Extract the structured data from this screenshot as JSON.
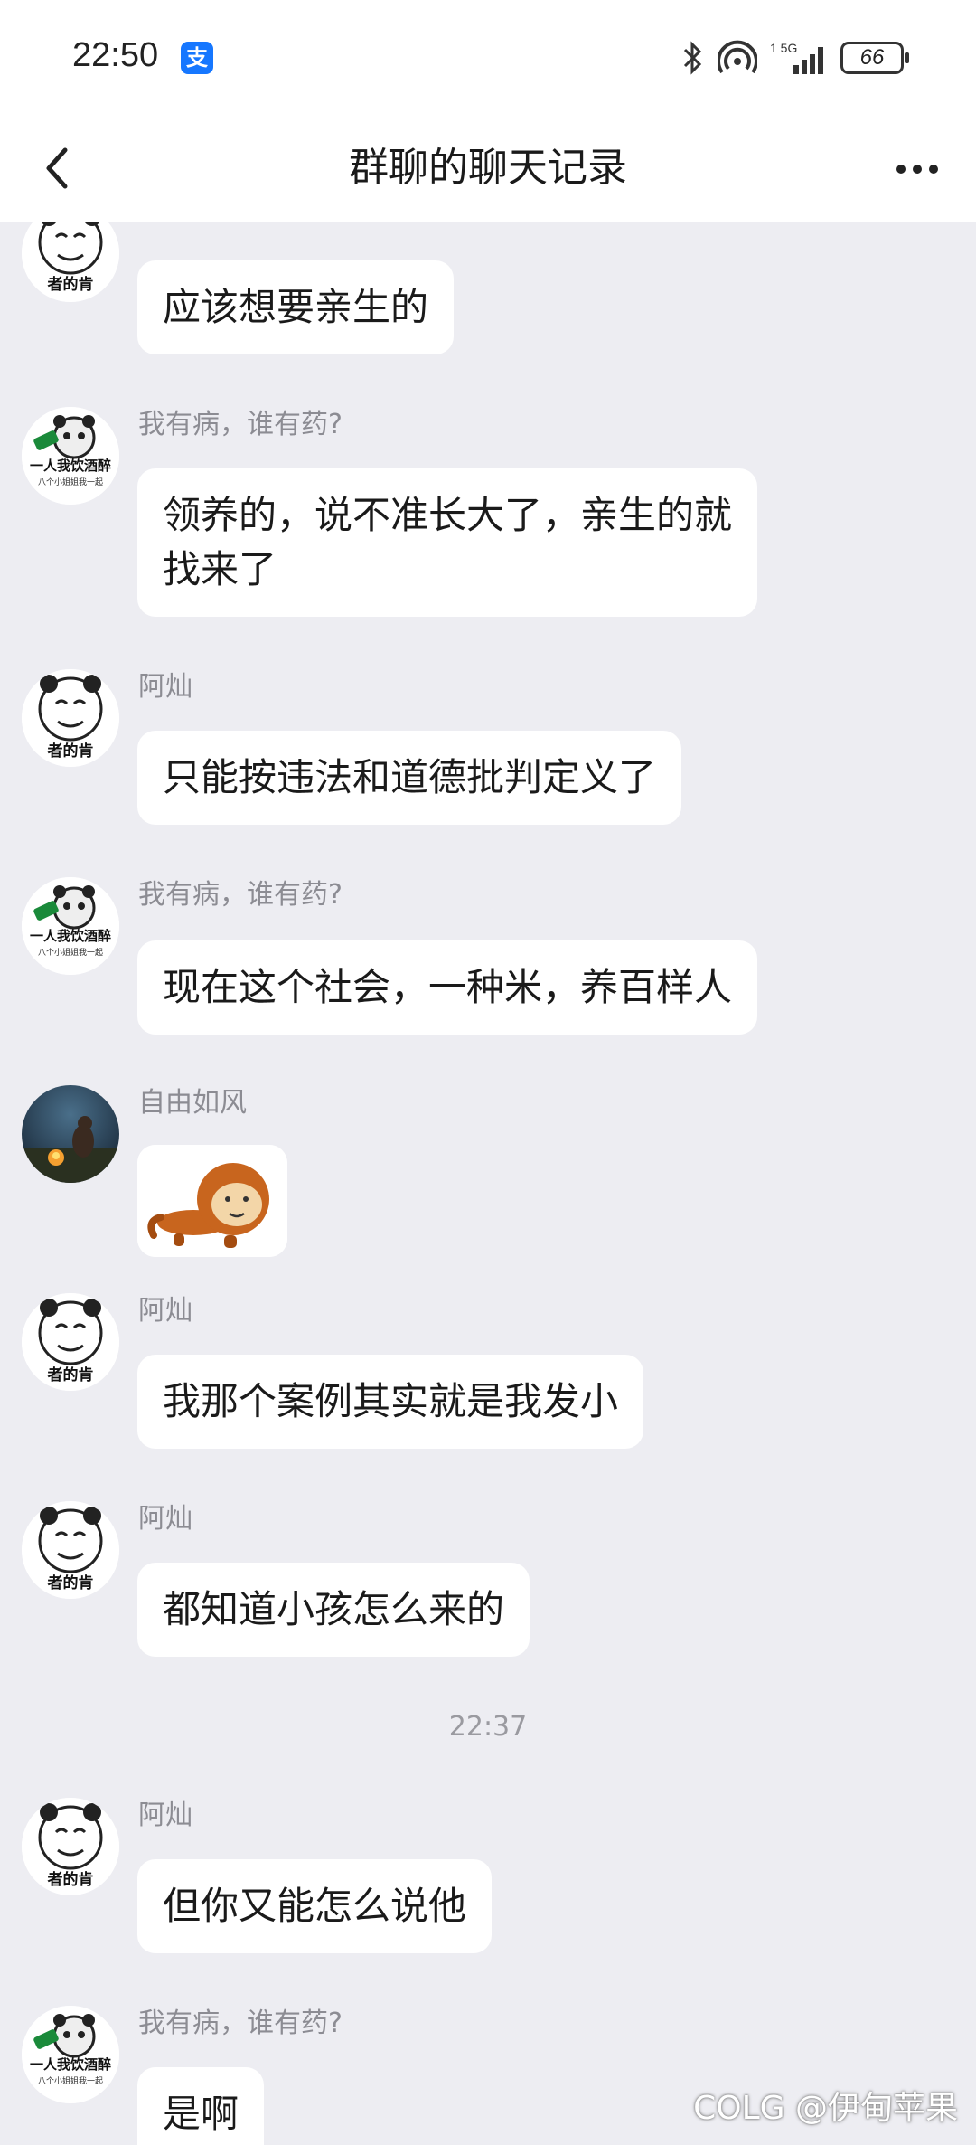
{
  "status_bar": {
    "time": "22:50",
    "alipay_icon": "支",
    "battery": "66"
  },
  "header": {
    "title": "群聊的聊天记录"
  },
  "messages": [
    {
      "sender": "阿灿",
      "text": "应该想要亲生的",
      "avatar": "panda-meme-a"
    },
    {
      "sender": "我有病，谁有药?",
      "text": "领养的，说不准长大了，亲生的就\n找来了",
      "avatar": "panda-meme-b"
    },
    {
      "sender": "阿灿",
      "text": "只能按违法和道德批判定义了",
      "avatar": "panda-meme-a"
    },
    {
      "sender": "我有病，谁有药?",
      "text": "现在这个社会，一种米，养百样人",
      "avatar": "panda-meme-b"
    },
    {
      "sender": "自由如风",
      "sticker": "monkey-pushup-sticker",
      "avatar": "campfire-photo"
    },
    {
      "sender": "阿灿",
      "text": "我那个案例其实就是我发小",
      "avatar": "panda-meme-a"
    },
    {
      "sender": "阿灿",
      "text": "都知道小孩怎么来的",
      "avatar": "panda-meme-a"
    },
    {
      "sender": "阿灿",
      "text": "但你又能怎么说他",
      "avatar": "panda-meme-a"
    },
    {
      "sender": "我有病，谁有药?",
      "text": "是啊",
      "avatar": "panda-meme-b"
    }
  ],
  "time_separator": "22:37",
  "avatar_text": {
    "a": "者的肯",
    "b_line1": "一人我饮酒醉",
    "b_line2": "八个小姐姐我一起"
  },
  "watermark": "@伊甸苹果",
  "watermark_logo": "COLG"
}
